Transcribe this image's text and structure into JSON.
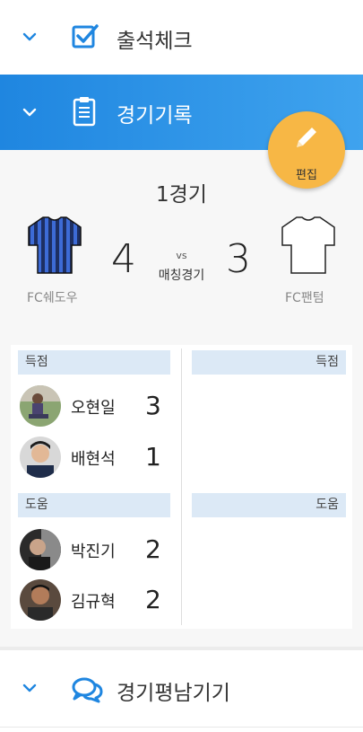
{
  "sections": {
    "attendance": {
      "label": "출석체크",
      "icon": "checkbox-icon"
    },
    "record": {
      "label": "경기기록",
      "icon": "clipboard-icon"
    },
    "review": {
      "label": "경기평남기기",
      "icon": "chat-bubbles-icon"
    }
  },
  "edit_button": {
    "label": "편집",
    "icon": "pencil-icon"
  },
  "match": {
    "title": "1경기",
    "home": {
      "name": "FC쉐도우",
      "score": "4"
    },
    "away": {
      "name": "FC팬텀",
      "score": "3"
    },
    "vs": "vs",
    "type": "매칭경기"
  },
  "stats": {
    "goals_label": "득점",
    "assists_label": "도움",
    "home_goals": [
      {
        "name": "오현일",
        "count": "3"
      },
      {
        "name": "배현석",
        "count": "1"
      }
    ],
    "home_assists": [
      {
        "name": "박진기",
        "count": "2"
      },
      {
        "name": "김규혁",
        "count": "2"
      }
    ]
  },
  "colors": {
    "accent": "#1f86e0",
    "fab": "#f7b745",
    "stat_bar": "#dce9f6"
  }
}
